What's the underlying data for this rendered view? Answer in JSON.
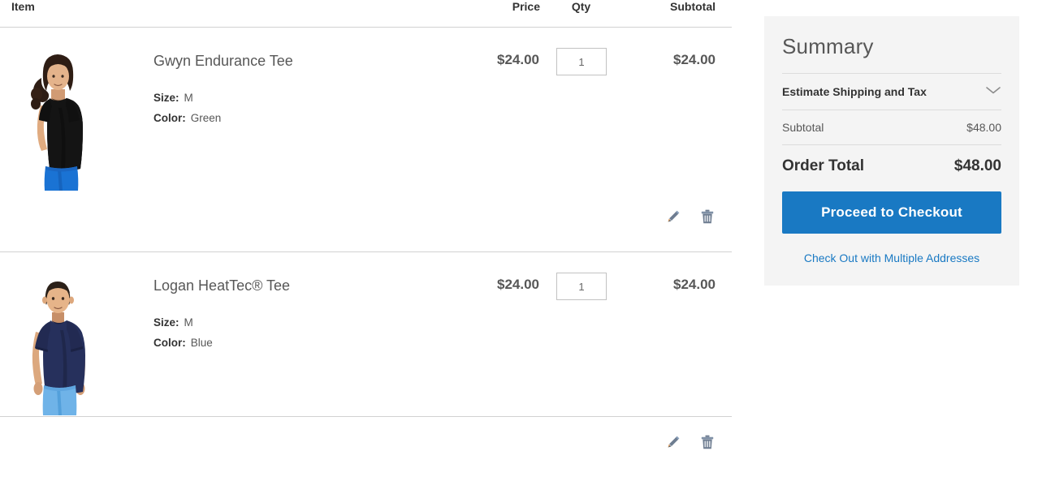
{
  "cart": {
    "columns": {
      "item": "Item",
      "price": "Price",
      "qty": "Qty",
      "subtotal": "Subtotal"
    },
    "items": [
      {
        "name": "Gwyn Endurance Tee",
        "price": "$24.00",
        "qty": "1",
        "subtotal": "$24.00",
        "options": [
          {
            "label": "Size:",
            "value": "M"
          },
          {
            "label": "Color:",
            "value": "Green"
          }
        ],
        "image_alt": "woman wearing black tee and blue shorts",
        "edit_icon": "pencil-icon",
        "delete_icon": "trash-icon"
      },
      {
        "name": "Logan HeatTec® Tee",
        "price": "$24.00",
        "qty": "1",
        "subtotal": "$24.00",
        "options": [
          {
            "label": "Size:",
            "value": "M"
          },
          {
            "label": "Color:",
            "value": "Blue"
          }
        ],
        "image_alt": "man wearing navy tee and light blue shorts",
        "edit_icon": "pencil-icon",
        "delete_icon": "trash-icon"
      }
    ]
  },
  "summary": {
    "title": "Summary",
    "estimate_label": "Estimate Shipping and Tax",
    "estimate_icon": "chevron-down-icon",
    "subtotal_label": "Subtotal",
    "subtotal_value": "$48.00",
    "order_total_label": "Order Total",
    "order_total_value": "$48.00",
    "checkout_label": "Proceed to Checkout",
    "multi_address_label": "Check Out with Multiple Addresses"
  },
  "colors": {
    "accent": "#1979c3",
    "panel_bg": "#f4f4f4",
    "text": "#333333",
    "muted_text": "#575757",
    "border": "#d1d1d1",
    "icon": "#7d8fa8"
  }
}
